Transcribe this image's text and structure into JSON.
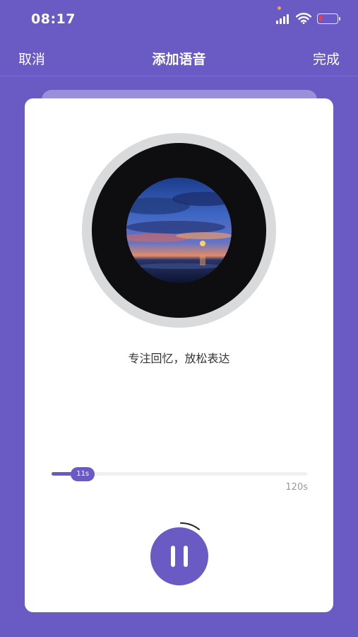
{
  "status_bar": {
    "time": "08:17",
    "icons": [
      "signal-icon",
      "wifi-icon",
      "battery-icon"
    ],
    "battery_color": "#ff3b30"
  },
  "nav": {
    "cancel_label": "取消",
    "title": "添加语音",
    "done_label": "完成"
  },
  "player": {
    "caption": "专注回忆，放松表达",
    "progress": {
      "current": 11,
      "max": 120,
      "current_label": "11s",
      "total_label": "120s"
    },
    "pause_icon": "pause-icon"
  },
  "colors": {
    "accent": "#6a5ac4",
    "card": "#ffffff",
    "disc": "#0e0e10"
  }
}
